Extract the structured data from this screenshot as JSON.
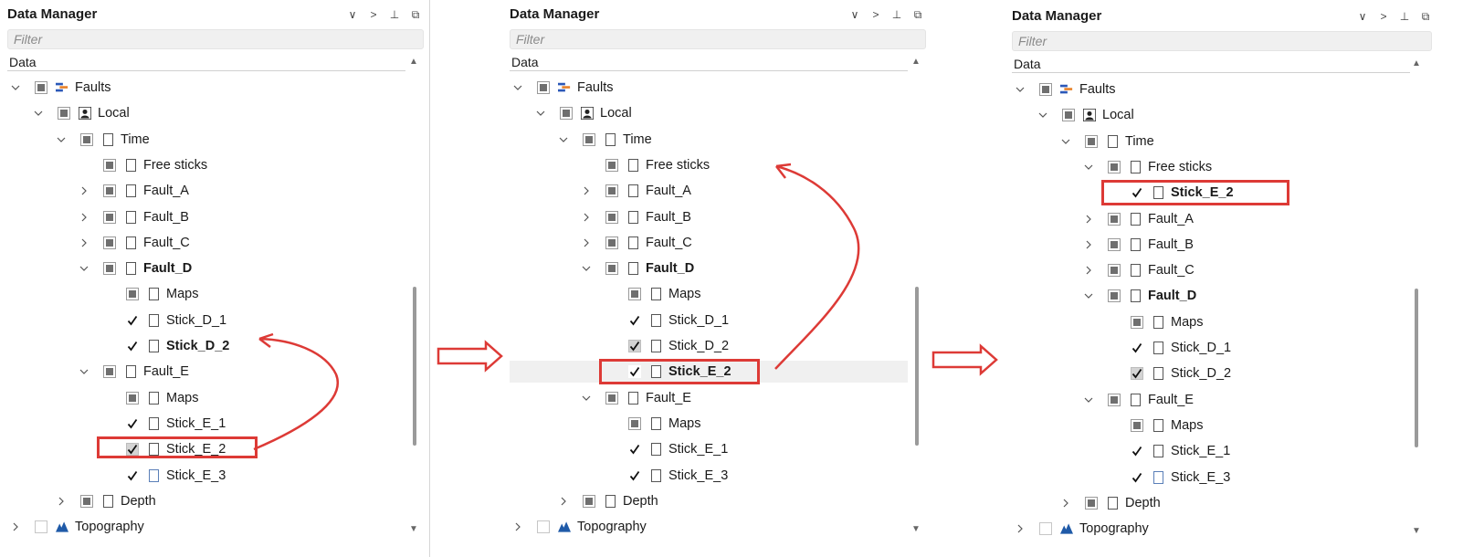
{
  "panels": [
    {
      "title": "Data Manager",
      "filter_placeholder": "Filter",
      "column_header": "Data",
      "toolbar_icons": [
        "chevron-down-icon",
        "chevron-right-icon",
        "pin-icon",
        "float-window-icon"
      ],
      "rows": [
        {
          "label": "Faults",
          "level": 0,
          "expander": "open",
          "check": "partial",
          "icon": "faults-icon"
        },
        {
          "label": "Local",
          "level": 1,
          "expander": "open",
          "check": "partial",
          "icon": "user-icon"
        },
        {
          "label": "Time",
          "level": 2,
          "expander": "open",
          "check": "partial",
          "icon": "doc"
        },
        {
          "label": "Free sticks",
          "level": 3,
          "expander": "none",
          "check": "partial",
          "icon": "doc"
        },
        {
          "label": "Fault_A",
          "level": 3,
          "expander": "closed",
          "check": "partial",
          "icon": "doc"
        },
        {
          "label": "Fault_B",
          "level": 3,
          "expander": "closed",
          "check": "partial",
          "icon": "doc"
        },
        {
          "label": "Fault_C",
          "level": 3,
          "expander": "closed",
          "check": "partial",
          "icon": "doc"
        },
        {
          "label": "Fault_D",
          "level": 3,
          "expander": "open",
          "check": "partial",
          "icon": "doc",
          "bold": true
        },
        {
          "label": "Maps",
          "level": 4,
          "expander": "none",
          "check": "partial",
          "icon": "doc"
        },
        {
          "label": "Stick_D_1",
          "level": 4,
          "expander": "none",
          "check": "check",
          "icon": "doc"
        },
        {
          "label": "Stick_D_2",
          "level": 4,
          "expander": "none",
          "check": "check",
          "icon": "doc",
          "bold": true
        },
        {
          "label": "Fault_E",
          "level": 3,
          "expander": "open",
          "check": "partial",
          "icon": "doc"
        },
        {
          "label": "Maps",
          "level": 4,
          "expander": "none",
          "check": "partial",
          "icon": "doc"
        },
        {
          "label": "Stick_E_1",
          "level": 4,
          "expander": "none",
          "check": "check",
          "icon": "doc"
        },
        {
          "label": "Stick_E_2",
          "level": 4,
          "expander": "none",
          "check": "check-grey",
          "icon": "doc",
          "boxed": true
        },
        {
          "label": "Stick_E_3",
          "level": 4,
          "expander": "none",
          "check": "check",
          "icon": "doc-blue"
        },
        {
          "label": "Depth",
          "level": 2,
          "expander": "closed",
          "check": "partial",
          "icon": "doc"
        },
        {
          "label": "Topography",
          "level": 0,
          "expander": "closed",
          "check": "empty",
          "icon": "topography-icon"
        }
      ]
    },
    {
      "title": "Data Manager",
      "filter_placeholder": "Filter",
      "column_header": "Data",
      "toolbar_icons": [
        "chevron-down-icon",
        "chevron-right-icon",
        "pin-icon",
        "float-window-icon"
      ],
      "rows": [
        {
          "label": "Faults",
          "level": 0,
          "expander": "open",
          "check": "partial",
          "icon": "faults-icon"
        },
        {
          "label": "Local",
          "level": 1,
          "expander": "open",
          "check": "partial",
          "icon": "user-icon"
        },
        {
          "label": "Time",
          "level": 2,
          "expander": "open",
          "check": "partial",
          "icon": "doc"
        },
        {
          "label": "Free sticks",
          "level": 3,
          "expander": "none",
          "check": "partial",
          "icon": "doc"
        },
        {
          "label": "Fault_A",
          "level": 3,
          "expander": "closed",
          "check": "partial",
          "icon": "doc"
        },
        {
          "label": "Fault_B",
          "level": 3,
          "expander": "closed",
          "check": "partial",
          "icon": "doc"
        },
        {
          "label": "Fault_C",
          "level": 3,
          "expander": "closed",
          "check": "partial",
          "icon": "doc"
        },
        {
          "label": "Fault_D",
          "level": 3,
          "expander": "open",
          "check": "partial",
          "icon": "doc",
          "bold": true
        },
        {
          "label": "Maps",
          "level": 4,
          "expander": "none",
          "check": "partial",
          "icon": "doc"
        },
        {
          "label": "Stick_D_1",
          "level": 4,
          "expander": "none",
          "check": "check",
          "icon": "doc"
        },
        {
          "label": "Stick_D_2",
          "level": 4,
          "expander": "none",
          "check": "check-grey",
          "icon": "doc"
        },
        {
          "label": "Stick_E_2",
          "level": 4,
          "expander": "none",
          "check": "check",
          "icon": "doc",
          "bold": true,
          "boxed": true,
          "highlight": true
        },
        {
          "label": "Fault_E",
          "level": 3,
          "expander": "open",
          "check": "partial",
          "icon": "doc"
        },
        {
          "label": "Maps",
          "level": 4,
          "expander": "none",
          "check": "partial",
          "icon": "doc"
        },
        {
          "label": "Stick_E_1",
          "level": 4,
          "expander": "none",
          "check": "check",
          "icon": "doc"
        },
        {
          "label": "Stick_E_3",
          "level": 4,
          "expander": "none",
          "check": "check",
          "icon": "doc"
        },
        {
          "label": "Depth",
          "level": 2,
          "expander": "closed",
          "check": "partial",
          "icon": "doc"
        },
        {
          "label": "Topography",
          "level": 0,
          "expander": "closed",
          "check": "empty",
          "icon": "topography-icon"
        }
      ]
    },
    {
      "title": "Data Manager",
      "filter_placeholder": "Filter",
      "column_header": "Data",
      "toolbar_icons": [
        "chevron-down-icon",
        "chevron-right-icon",
        "pin-icon",
        "float-window-icon"
      ],
      "rows": [
        {
          "label": "Faults",
          "level": 0,
          "expander": "open",
          "check": "partial",
          "icon": "faults-icon"
        },
        {
          "label": "Local",
          "level": 1,
          "expander": "open",
          "check": "partial",
          "icon": "user-icon"
        },
        {
          "label": "Time",
          "level": 2,
          "expander": "open",
          "check": "partial",
          "icon": "doc"
        },
        {
          "label": "Free sticks",
          "level": 3,
          "expander": "open",
          "check": "partial",
          "icon": "doc"
        },
        {
          "label": "Stick_E_2",
          "level": 4,
          "expander": "none",
          "check": "check",
          "icon": "doc",
          "bold": true,
          "boxed": true
        },
        {
          "label": "Fault_A",
          "level": 3,
          "expander": "closed",
          "check": "partial",
          "icon": "doc"
        },
        {
          "label": "Fault_B",
          "level": 3,
          "expander": "closed",
          "check": "partial",
          "icon": "doc"
        },
        {
          "label": "Fault_C",
          "level": 3,
          "expander": "closed",
          "check": "partial",
          "icon": "doc"
        },
        {
          "label": "Fault_D",
          "level": 3,
          "expander": "open",
          "check": "partial",
          "icon": "doc",
          "bold": true
        },
        {
          "label": "Maps",
          "level": 4,
          "expander": "none",
          "check": "partial",
          "icon": "doc"
        },
        {
          "label": "Stick_D_1",
          "level": 4,
          "expander": "none",
          "check": "check",
          "icon": "doc"
        },
        {
          "label": "Stick_D_2",
          "level": 4,
          "expander": "none",
          "check": "check-grey",
          "icon": "doc"
        },
        {
          "label": "Fault_E",
          "level": 3,
          "expander": "open",
          "check": "partial",
          "icon": "doc"
        },
        {
          "label": "Maps",
          "level": 4,
          "expander": "none",
          "check": "partial",
          "icon": "doc"
        },
        {
          "label": "Stick_E_1",
          "level": 4,
          "expander": "none",
          "check": "check",
          "icon": "doc"
        },
        {
          "label": "Stick_E_3",
          "level": 4,
          "expander": "none",
          "check": "check",
          "icon": "doc-blue"
        },
        {
          "label": "Depth",
          "level": 2,
          "expander": "closed",
          "check": "partial",
          "icon": "doc"
        },
        {
          "label": "Topography",
          "level": 0,
          "expander": "closed",
          "check": "empty",
          "icon": "topography-icon"
        }
      ]
    }
  ],
  "colors": {
    "annotation_red": "#dd3a36",
    "faults_blue": "#2b58b8",
    "faults_orange": "#e8822a",
    "topography_blue": "#1f5aa8"
  }
}
